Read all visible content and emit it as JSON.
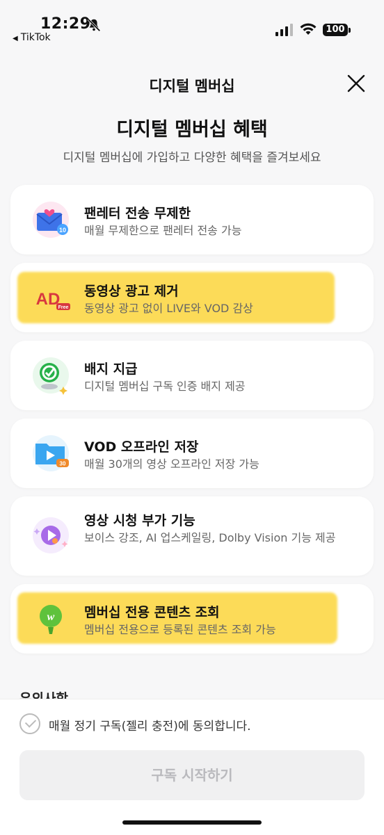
{
  "status_bar": {
    "time": "12:29",
    "back_app": "TikTok",
    "battery": "100",
    "icons": [
      "bell-off-icon",
      "signal-icon",
      "wifi-icon",
      "battery-icon"
    ]
  },
  "header": {
    "title": "디지털 멤버십",
    "close_icon": "close-icon"
  },
  "hero": {
    "title": "디지털 멤버십 혜택",
    "subtitle": "디지털 멤버십에 가입하고 다양한 혜택을 즐겨보세요"
  },
  "benefits": [
    {
      "title": "팬레터 전송 무제한",
      "desc": "매월 무제한으로 팬레터 전송 가능",
      "icon": "letter-icon",
      "highlighted": false
    },
    {
      "title": "동영상 광고 제거",
      "desc": "동영상 광고 없이 LIVE와 VOD 감상",
      "icon": "ad-free-icon",
      "highlighted": true
    },
    {
      "title": "배지 지급",
      "desc": "디지털 멤버십 구독 인증 배지 제공",
      "icon": "badge-icon",
      "highlighted": false
    },
    {
      "title": "VOD 오프라인 저장",
      "desc": "매월 30개의 영상 오프라인 저장 가능",
      "icon": "offline-folder-icon",
      "highlighted": false
    },
    {
      "title": "영상 시청 부가 기능",
      "desc": "보이스 강조, AI 업스케일링, Dolby Vision 기능 제공",
      "icon": "video-feature-icon",
      "highlighted": false
    },
    {
      "title": "멤버십 전용 콘텐츠 조회",
      "desc": "멤버십 전용으로 등록된 콘텐츠 조회 가능",
      "icon": "exclusive-content-icon",
      "highlighted": true
    }
  ],
  "partial_section_title": "유의사항",
  "bottom": {
    "agree_text": "매월 정기 구독(젤리 충전)에 동의합니다.",
    "start_button": "구독 시작하기"
  },
  "colors": {
    "highlight": "#fcd94a",
    "background": "#f7f7f8",
    "disabled_button": "#f0f0f1"
  }
}
